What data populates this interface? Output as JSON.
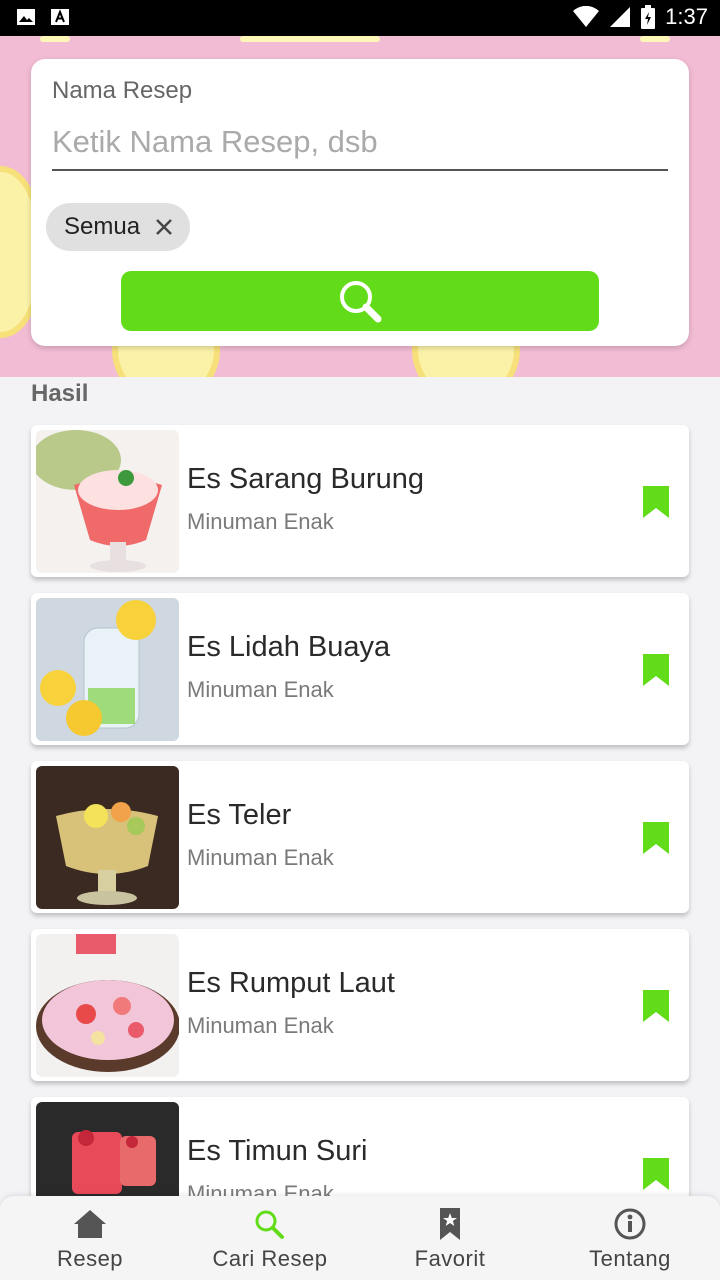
{
  "status_bar": {
    "time": "1:37"
  },
  "search": {
    "label": "Nama Resep",
    "placeholder": "Ketik Nama Resep, dsb",
    "chip_label": "Semua"
  },
  "results": {
    "heading": "Hasil",
    "items": [
      {
        "title": "Es Sarang Burung",
        "subtitle": "Minuman Enak"
      },
      {
        "title": "Es Lidah Buaya",
        "subtitle": "Minuman Enak"
      },
      {
        "title": "Es Teler",
        "subtitle": "Minuman Enak"
      },
      {
        "title": "Es Rumput Laut",
        "subtitle": "Minuman Enak"
      },
      {
        "title": "Es Timun Suri",
        "subtitle": "Minuman Enak"
      }
    ]
  },
  "bottom_nav": {
    "items": [
      {
        "label": "Resep",
        "icon": "home-icon",
        "active": false
      },
      {
        "label": "Cari Resep",
        "icon": "search-icon",
        "active": true
      },
      {
        "label": "Favorit",
        "icon": "bookmark-icon",
        "active": false
      },
      {
        "label": "Tentang",
        "icon": "info-icon",
        "active": false
      }
    ]
  },
  "colors": {
    "accent": "#62dc19",
    "header_bg": "#f2bcd4",
    "bookmark": "#62dc19",
    "nav_active": "#62dc19"
  }
}
